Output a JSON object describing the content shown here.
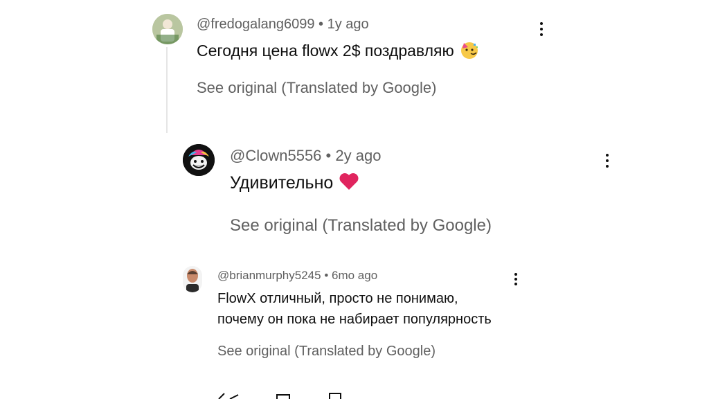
{
  "comments": [
    {
      "handle": "@fredogalang6099",
      "age": "1y ago",
      "text": "Сегодня цена flowx 2$ поздравляю",
      "emoji": "party-face",
      "see_original": "See original (Translated by Google)"
    },
    {
      "handle": "@Clown5556",
      "age": "2y ago",
      "text": "Удивительно",
      "emoji": "red-heart",
      "see_original": "See original (Translated by Google)"
    },
    {
      "handle": "@brianmurphy5245",
      "age": "6mo ago",
      "text_line1": "FlowX отличный, просто не понимаю,",
      "text_line2": "почему он пока не набирает популярность",
      "see_original": "See original (Translated by Google)"
    }
  ],
  "separator": "•",
  "colors": {
    "secondary_text": "#606060",
    "primary_text": "#0f0f0f",
    "heart": "#e0245e"
  }
}
